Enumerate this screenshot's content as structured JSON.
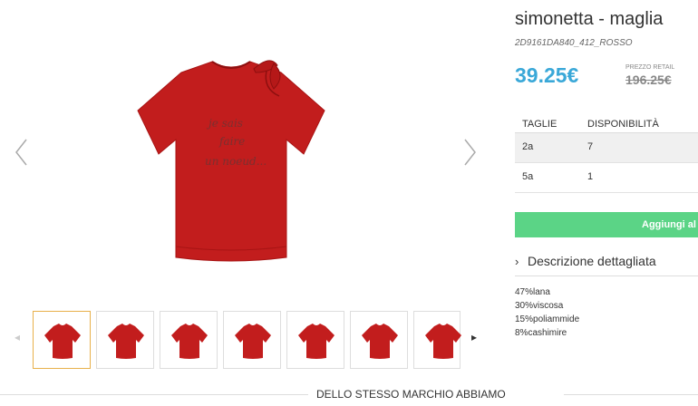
{
  "product": {
    "title": "simonetta - maglia",
    "code": "2D9161DA840_412_ROSSO",
    "price": "39.25€",
    "retail_label": "PREZZO RETAIL",
    "retail_price": "196.25€"
  },
  "sizes_table": {
    "headers": [
      "TAGLIE",
      "DISPONIBILITÀ"
    ],
    "rows": [
      {
        "size": "2a",
        "qty": "7"
      },
      {
        "size": "5a",
        "qty": "1"
      }
    ]
  },
  "cart": {
    "add_label": "Aggiungi al c"
  },
  "description": {
    "heading": "Descrizione dettagliata",
    "composition": [
      "47%lana",
      "30%viscosa",
      "15%poliammide",
      "8%cashimire"
    ]
  },
  "brand_section": {
    "heading": "DELLO STESSO MARCHIO ABBIAMO"
  },
  "icons": {
    "gallery_prev": "chevron-left-icon",
    "gallery_next": "chevron-right-icon",
    "thumbs_prev": "caret-left-icon",
    "thumbs_next": "caret-right-icon",
    "desc_toggle": "chevron-right-icon"
  },
  "colors": {
    "price": "#3aa8d8",
    "add_button": "#5bd486",
    "garment": "#c21d1d",
    "active_thumb_border": "#e8b04a"
  }
}
